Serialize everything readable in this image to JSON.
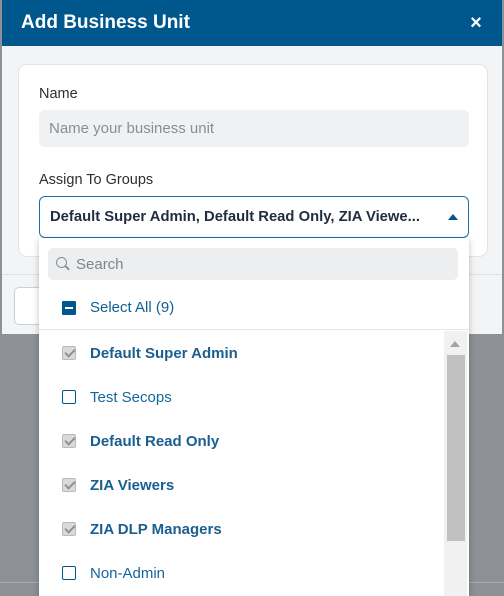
{
  "modal": {
    "title": "Add Business Unit",
    "close_glyph": "×"
  },
  "form": {
    "name_label": "Name",
    "name_placeholder": "Name your business unit",
    "groups_label": "Assign To Groups",
    "groups_value": "Default Super Admin, Default Read Only, ZIA Viewe..."
  },
  "dropdown": {
    "search_placeholder": "Search",
    "select_all_label": "Select All (9)",
    "items": [
      {
        "label": "Default Super Admin",
        "checked": true
      },
      {
        "label": "Test Secops",
        "checked": false
      },
      {
        "label": "Default Read Only",
        "checked": true
      },
      {
        "label": "ZIA Viewers",
        "checked": true
      },
      {
        "label": "ZIA DLP Managers",
        "checked": true
      },
      {
        "label": "Non-Admin",
        "checked": false
      }
    ]
  },
  "colors": {
    "header": "#00578e",
    "accent": "#1d6ea8",
    "link_text": "#14679d"
  }
}
